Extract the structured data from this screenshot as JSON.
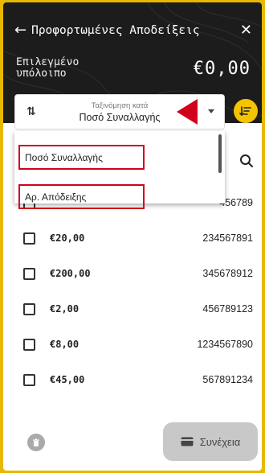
{
  "header": {
    "title": "Προφορτωμένες Αποδείξεις",
    "back_icon": "arrow-left-icon",
    "close_icon": "close-icon",
    "balance_label": "Επιλεγμένο\nυπόλοιπο",
    "balance_value": "€0,00"
  },
  "sort": {
    "caption": "Ταξινόμηση κατά",
    "value": "Ποσό Συναλλαγής",
    "options": [
      "Ποσό Συναλλαγής",
      "Αρ. Απόδειξης"
    ]
  },
  "rows": [
    {
      "amount": "",
      "receipt": "456789"
    },
    {
      "amount": "€20,00",
      "receipt": "234567891"
    },
    {
      "amount": "€200,00",
      "receipt": "345678912"
    },
    {
      "amount": "€2,00",
      "receipt": "456789123"
    },
    {
      "amount": "€8,00",
      "receipt": "1234567890"
    },
    {
      "amount": "€45,00",
      "receipt": "567891234"
    }
  ],
  "footer": {
    "continue_label": "Συνέχεια"
  },
  "colors": {
    "accent": "#f5c400",
    "highlight": "#d0021b",
    "header_bg": "#1c1c1c"
  }
}
